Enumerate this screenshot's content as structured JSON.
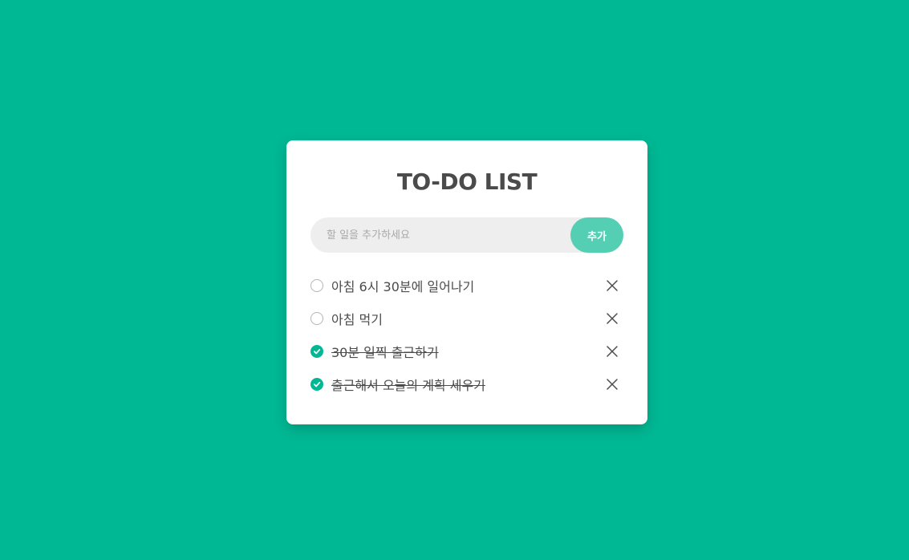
{
  "app": {
    "title": "TO-DO LIST"
  },
  "input": {
    "placeholder": "할 일을 추가하세요",
    "value": ""
  },
  "add_button": {
    "label": "추가"
  },
  "todos": [
    {
      "text": "아침 6시 30분에 일어나기",
      "done": false
    },
    {
      "text": "아침 먹기",
      "done": false
    },
    {
      "text": "30분 일찍 출근하기",
      "done": true
    },
    {
      "text": "출근해서 오늘의 계획 세우기",
      "done": true
    }
  ],
  "icons": {
    "check": "check-icon",
    "delete": "close-icon"
  },
  "colors": {
    "background": "#00b894",
    "accent": "#00b894",
    "add_button": "#55cfb4",
    "text": "#4b4b4b"
  }
}
